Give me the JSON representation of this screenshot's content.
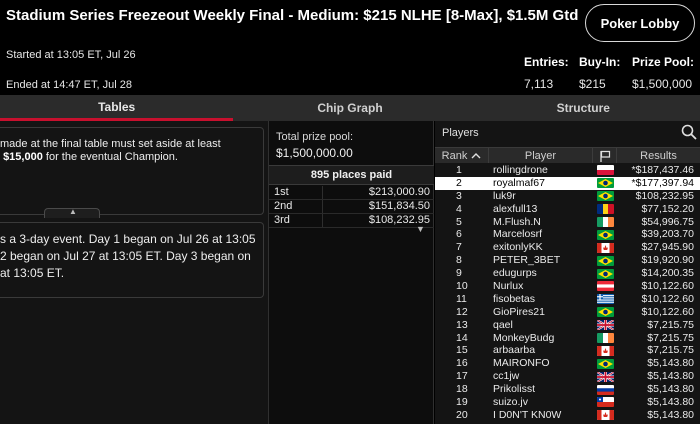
{
  "header": {
    "title": "Stadium Series Freezeout Weekly Final - Medium: $215 NLHE [8-Max], $1.5M Gtd",
    "lobby_button": "Poker Lobby",
    "started": "Started at 13:05 ET, Jul 26",
    "ended": "Ended at 14:47 ET, Jul 28",
    "entries_label": "Entries:",
    "entries_value": "7,113",
    "buyin_label": "Buy-In:",
    "buyin_value": "$215",
    "prizepool_label": "Prize Pool:",
    "prizepool_value": "$1,500,000"
  },
  "tabs": [
    {
      "label": "Tables",
      "active": true
    },
    {
      "label": "Chip Graph",
      "active": false
    },
    {
      "label": "Structure",
      "active": false
    }
  ],
  "left_panel": {
    "rules_line1": "made at the final table must set aside at least",
    "rules_amount": "$15,000",
    "rules_line2_rest": "for the eventual Champion.",
    "info_line1": "s a 3-day event. Day 1 began on Jul 26 at 13:05",
    "info_line2": "2 began on Jul 27 at 13:05 ET. Day 3 began on",
    "info_line3": "at 13:05 ET."
  },
  "middle_panel": {
    "total_prize_label": "Total prize pool:",
    "total_prize_value": "$1,500,000.00",
    "places_paid": "895 places paid",
    "payouts": [
      {
        "place": "1st",
        "amount": "$213,000.90"
      },
      {
        "place": "2nd",
        "amount": "$151,834.50"
      },
      {
        "place": "3rd",
        "amount": "$108,232.95"
      }
    ]
  },
  "players_panel": {
    "title": "Players",
    "columns": {
      "rank": "Rank",
      "player": "Player",
      "results": "Results"
    },
    "accent_color": "#c8102e",
    "rows": [
      {
        "rank": "1",
        "player": "rollingdrone",
        "flag": "poland",
        "result": "*$187,437.46"
      },
      {
        "rank": "2",
        "player": "royalmaf67",
        "flag": "brazil",
        "result": "*$177,397.94",
        "highlight": true
      },
      {
        "rank": "3",
        "player": "luk9r",
        "flag": "brazil",
        "result": "$108,232.95"
      },
      {
        "rank": "4",
        "player": "alexfull13",
        "flag": "romania",
        "result": "$77,152.20"
      },
      {
        "rank": "5",
        "player": "M.Flush.N",
        "flag": "ireland",
        "result": "$54,996.75"
      },
      {
        "rank": "6",
        "player": "Marcelosrf",
        "flag": "brazil",
        "result": "$39,203.70"
      },
      {
        "rank": "7",
        "player": "exitonlyKK",
        "flag": "canada",
        "result": "$27,945.90"
      },
      {
        "rank": "8",
        "player": "PETER_3BET",
        "flag": "brazil",
        "result": "$19,920.90"
      },
      {
        "rank": "9",
        "player": "edugurps",
        "flag": "brazil",
        "result": "$14,200.35"
      },
      {
        "rank": "10",
        "player": "Nurlux",
        "flag": "austria",
        "result": "$10,122.60"
      },
      {
        "rank": "11",
        "player": "fisobetas",
        "flag": "greece",
        "result": "$10,122.60"
      },
      {
        "rank": "12",
        "player": "GioPires21",
        "flag": "brazil",
        "result": "$10,122.60"
      },
      {
        "rank": "13",
        "player": "qael",
        "flag": "uk",
        "result": "$7,215.75"
      },
      {
        "rank": "14",
        "player": "MonkeyBudg",
        "flag": "ireland",
        "result": "$7,215.75"
      },
      {
        "rank": "15",
        "player": "arbaarba",
        "flag": "canada",
        "result": "$7,215.75"
      },
      {
        "rank": "16",
        "player": "MAIRONFO",
        "flag": "brazil",
        "result": "$5,143.80"
      },
      {
        "rank": "17",
        "player": "cc1jw",
        "flag": "uk",
        "result": "$5,143.80"
      },
      {
        "rank": "18",
        "player": "Prikolisst",
        "flag": "russia",
        "result": "$5,143.80"
      },
      {
        "rank": "19",
        "player": "suizo.jv",
        "flag": "chile",
        "result": "$5,143.80"
      },
      {
        "rank": "20",
        "player": "I D0N'T KN0W",
        "flag": "canada",
        "result": "$5,143.80"
      }
    ]
  }
}
